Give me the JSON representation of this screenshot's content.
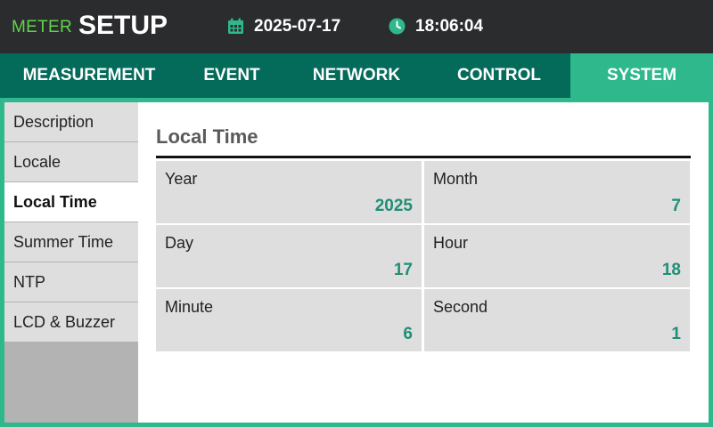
{
  "header": {
    "brand_small": "METER",
    "brand_large": "SETUP",
    "date": "2025-07-17",
    "time": "18:06:04",
    "date_icon": "calendar-icon",
    "time_icon": "clock-icon"
  },
  "tabs": [
    {
      "label": "MEASUREMENT",
      "active": false
    },
    {
      "label": "EVENT",
      "active": false
    },
    {
      "label": "NETWORK",
      "active": false
    },
    {
      "label": "CONTROL",
      "active": false
    },
    {
      "label": "SYSTEM",
      "active": true
    }
  ],
  "sidebar": {
    "items": [
      {
        "label": "Description",
        "active": false
      },
      {
        "label": "Locale",
        "active": false
      },
      {
        "label": "Local Time",
        "active": true
      },
      {
        "label": "Summer Time",
        "active": false
      },
      {
        "label": "NTP",
        "active": false
      },
      {
        "label": "LCD & Buzzer",
        "active": false
      }
    ]
  },
  "main": {
    "title": "Local Time",
    "fields": [
      {
        "label": "Year",
        "value": "2025"
      },
      {
        "label": "Month",
        "value": "7"
      },
      {
        "label": "Day",
        "value": "17"
      },
      {
        "label": "Hour",
        "value": "18"
      },
      {
        "label": "Minute",
        "value": "6"
      },
      {
        "label": "Second",
        "value": "1"
      }
    ]
  },
  "colors": {
    "header_bg": "#2b2c2e",
    "tab_bg": "#046a5a",
    "accent": "#2fb88b",
    "brand_green": "#5fd64a",
    "value_text": "#1f8f76"
  }
}
